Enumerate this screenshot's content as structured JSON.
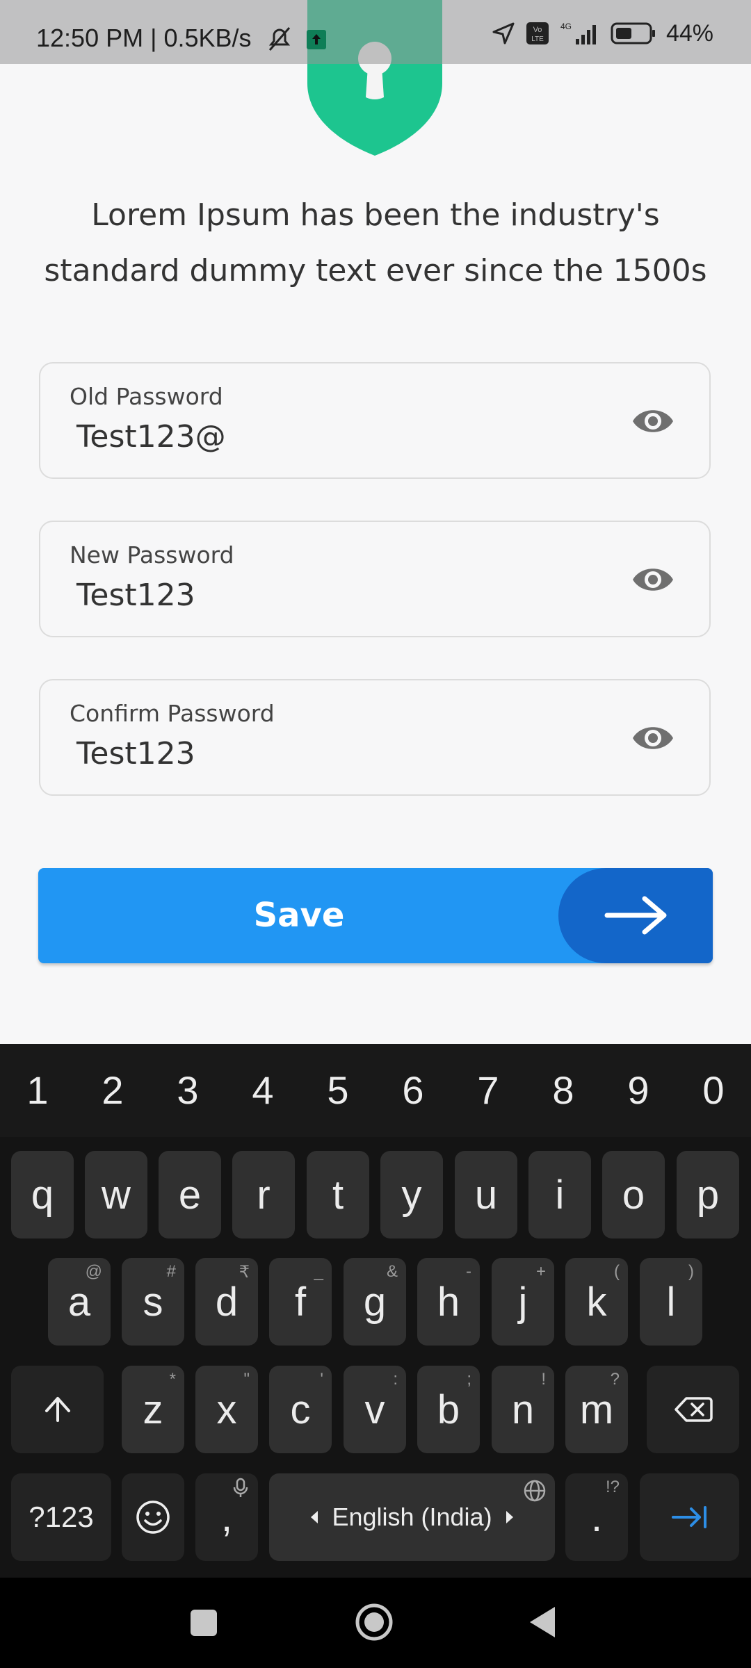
{
  "status_bar": {
    "time": "12:50 PM | 0.5KB/s",
    "battery": "44%"
  },
  "headline": {
    "line1": "Lorem Ipsum has been the industry's",
    "line2": "standard dummy text ever since the 1500s"
  },
  "fields": [
    {
      "label": "Old Password",
      "value": "Test123@"
    },
    {
      "label": "New Password",
      "value": "Test123"
    },
    {
      "label": "Confirm Password",
      "value": "Test123"
    }
  ],
  "save_button": {
    "label": "Save"
  },
  "keyboard": {
    "numbers": [
      "1",
      "2",
      "3",
      "4",
      "5",
      "6",
      "7",
      "8",
      "9",
      "0"
    ],
    "row1": [
      "q",
      "w",
      "e",
      "r",
      "t",
      "y",
      "u",
      "i",
      "o",
      "p"
    ],
    "row2": [
      "a",
      "s",
      "d",
      "f",
      "g",
      "h",
      "j",
      "k",
      "l"
    ],
    "row2_hints": [
      "@",
      "#",
      "₹",
      "_",
      "&",
      "-",
      "+",
      "(",
      ")"
    ],
    "row3": [
      "z",
      "x",
      "c",
      "v",
      "b",
      "n",
      "m"
    ],
    "row3_hints": [
      "*",
      "\"",
      "'",
      ":",
      ";",
      "!",
      "?"
    ],
    "symbols_key": "?123",
    "comma_key": ",",
    "space_label": "English (India)",
    "period_key": ".",
    "period_hint": "!?"
  },
  "colors": {
    "accent": "#2196f3",
    "accent_dark": "#1366c9",
    "shield": "#1dc58f"
  }
}
